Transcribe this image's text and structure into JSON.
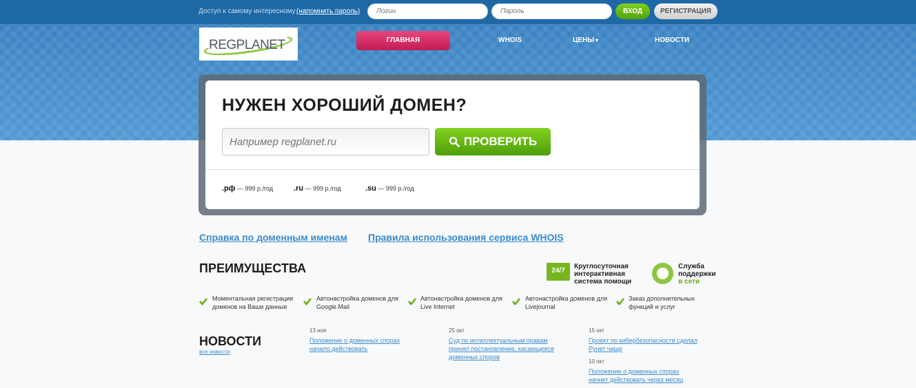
{
  "topbar": {
    "access_text": "Доступ к самому интересному",
    "remind_link": "(напомнить пароль)",
    "login_placeholder": "Логин",
    "password_placeholder": "Пароль",
    "login_button": "ВХОД",
    "register_button": "РЕГИСТРАЦИЯ"
  },
  "logo": {
    "text": "REGPLANET"
  },
  "nav": {
    "items": [
      "ГЛАВНАЯ",
      "WHOIS",
      "ЦЕНЫ",
      "НОВОСТИ"
    ],
    "prices_arrow": "▾"
  },
  "search": {
    "title": "НУЖЕН ХОРОШИЙ ДОМЕН?",
    "placeholder": "Например regplanet.ru",
    "button": "ПРОВЕРИТЬ",
    "prices": [
      {
        "zone": ".рф",
        "price": "— 999 р./год"
      },
      {
        "zone": ".ru",
        "price": "— 999 р./год"
      },
      {
        "zone": ".su",
        "price": "— 999 р./год"
      }
    ]
  },
  "links": {
    "help": "Справка по доменным именам",
    "whois_rules": "Правила использования сервиса WHOIS"
  },
  "advantages": {
    "title": "ПРЕИМУЩЕСТВА",
    "support247_badge": "24/7",
    "support247_text": [
      "Круглосуточная",
      "интерактивная",
      "система помощи"
    ],
    "support_online_text": [
      "Служба",
      "поддержки"
    ],
    "support_online_status": "в сети",
    "features": [
      [
        "Моментальная регистрация",
        "доменов на Ваши данные"
      ],
      [
        "Автонастройка доменов для",
        "Google.Mail"
      ],
      [
        "Автонастройка доменов для",
        "Live Internet"
      ],
      [
        "Автонастройка доменов для",
        "Livejournal"
      ],
      [
        "Заказ дополнительных",
        "функций и услуг"
      ]
    ]
  },
  "news": {
    "title": "НОВОСТИ",
    "all_news": "все новости",
    "items": [
      {
        "date": "13 ноя",
        "lines": [
          "Положение о доменных спорах",
          "начало действовать"
        ]
      },
      {
        "date": "25 окт",
        "lines": [
          "Суд по интеллектуальным правам",
          "принял постановление, касающееся",
          "доменных споров"
        ]
      },
      {
        "date": "15 окт",
        "lines": [
          "Проект по кибербезопасности сделал",
          "Рунет чище"
        ]
      },
      {
        "date": "10 окт",
        "lines": [
          "Положение о доменных спорах",
          "начнет действовать через месяц"
        ]
      }
    ]
  },
  "colors": {
    "topbar": "#1e68a6",
    "accent_green": "#6aaa12",
    "nav_active": "#d42f68",
    "link": "#3a8ac9"
  }
}
